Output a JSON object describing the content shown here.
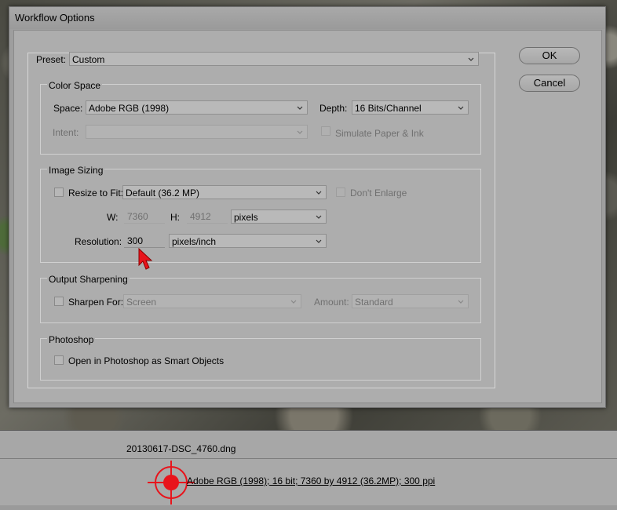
{
  "dialog": {
    "title": "Workflow Options",
    "preset_label": "Preset:",
    "preset_value": "Custom",
    "ok_label": "OK",
    "cancel_label": "Cancel"
  },
  "color_space": {
    "title": "Color Space",
    "space_label": "Space:",
    "space_value": "Adobe RGB (1998)",
    "depth_label": "Depth:",
    "depth_value": "16 Bits/Channel",
    "intent_label": "Intent:",
    "intent_value": "",
    "simulate_label": "Simulate Paper & Ink"
  },
  "image_sizing": {
    "title": "Image Sizing",
    "resize_label": "Resize to Fit:",
    "resize_value": "Default  (36.2 MP)",
    "dont_enlarge_label": "Don't Enlarge",
    "w_label": "W:",
    "w_value": "7360",
    "h_label": "H:",
    "h_value": "4912",
    "units_value": "pixels",
    "resolution_label": "Resolution:",
    "resolution_value": "300",
    "resolution_units": "pixels/inch"
  },
  "output_sharpening": {
    "title": "Output Sharpening",
    "sharpen_label": "Sharpen For:",
    "sharpen_value": "Screen",
    "amount_label": "Amount:",
    "amount_value": "Standard"
  },
  "photoshop": {
    "title": "Photoshop",
    "smart_objects_label": "Open in Photoshop as Smart Objects"
  },
  "status": {
    "filename": "20130617-DSC_4760.dng",
    "workflow_link": "Adobe RGB (1998); 16 bit; 7360 by 4912 (36.2MP); 300 ppi"
  },
  "colors": {
    "annotation_red": "#e8141c",
    "dialog_bg": "#adadad"
  }
}
